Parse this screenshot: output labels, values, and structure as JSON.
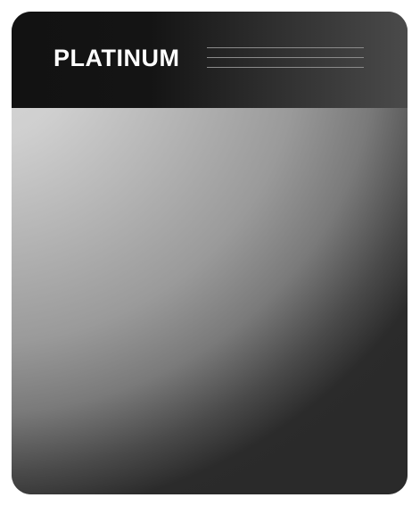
{
  "card": {
    "title": "PLATINUM"
  },
  "colors": {
    "header_dark": "#121212",
    "header_light": "#4a4a4a",
    "body_light": "#d8d8d8",
    "body_dark": "#2a2a2a",
    "title_text": "#ffffff"
  }
}
